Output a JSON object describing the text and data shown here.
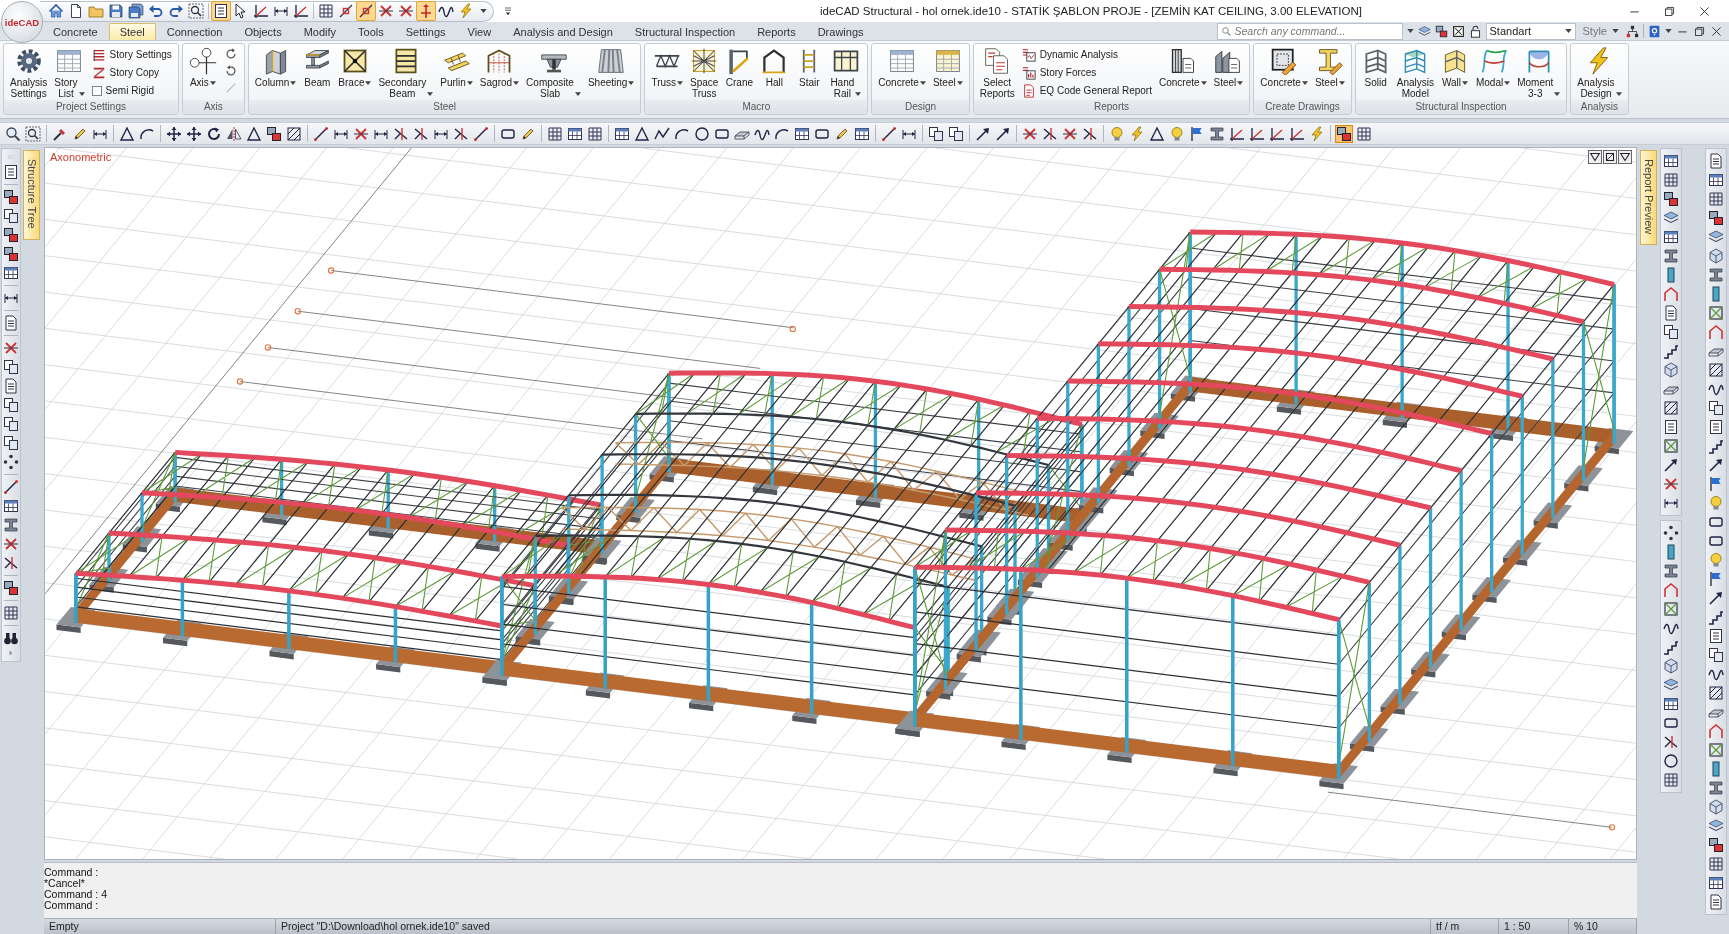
{
  "title_bar": {
    "logo": "ideCAD",
    "title": "ideCAD Structural - hol ornek.ide10 - STATİK ŞABLON PROJE - [ZEMİN KAT CEILING, 3.00 ELEVATION]"
  },
  "quick_access": [
    {
      "on": false
    },
    {
      "on": false
    },
    {
      "on": false
    },
    {
      "on": false
    },
    {
      "on": false
    },
    {
      "on": false
    },
    {
      "on": false
    },
    {
      "on": false
    },
    {
      "on": true
    },
    {
      "on": false
    },
    {
      "on": false
    },
    {
      "on": false
    },
    {
      "on": false
    },
    {
      "on": false
    },
    {
      "on": false
    },
    {
      "on": true
    },
    {
      "on": false
    },
    {
      "on": false
    },
    {
      "on": true
    },
    {
      "on": false
    },
    {
      "on": false
    }
  ],
  "tabs": [
    {
      "label": "Concrete",
      "selected": false
    },
    {
      "label": "Steel",
      "selected": true
    },
    {
      "label": "Connection",
      "selected": false
    },
    {
      "label": "Objects",
      "selected": false
    },
    {
      "label": "Modify",
      "selected": false
    },
    {
      "label": "Tools",
      "selected": false
    },
    {
      "label": "Settings",
      "selected": false
    },
    {
      "label": "View",
      "selected": false
    },
    {
      "label": "Analysis and Design",
      "selected": false
    },
    {
      "label": "Structural Inspection",
      "selected": false
    },
    {
      "label": "Reports",
      "selected": false
    },
    {
      "label": "Drawings",
      "selected": false
    }
  ],
  "search": {
    "placeholder": "Search any command..."
  },
  "style_dropdown": {
    "value": "Standart"
  },
  "style_menu": {
    "label": "Style"
  },
  "ribbon": [
    {
      "title": "Project Settings",
      "items": [
        {
          "kind": "large",
          "label": "Analysis Settings",
          "menu": false
        },
        {
          "kind": "large",
          "label": "Story List",
          "menu": true
        },
        {
          "kind": "small",
          "label": "Story Settings"
        },
        {
          "kind": "small",
          "label": "Story Copy"
        },
        {
          "kind": "check",
          "label": "Semi Rigid",
          "checked": false
        }
      ]
    },
    {
      "title": "Axis",
      "items": [
        {
          "kind": "large",
          "label": "Axis",
          "menu": true
        },
        {
          "kind": "icon"
        },
        {
          "kind": "icon"
        },
        {
          "kind": "icon"
        }
      ]
    },
    {
      "title": "Steel",
      "items": [
        {
          "kind": "large",
          "label": "Column",
          "menu": true
        },
        {
          "kind": "large",
          "label": "Beam",
          "menu": false
        },
        {
          "kind": "large",
          "label": "Brace",
          "menu": true
        },
        {
          "kind": "large",
          "label": "Secondary Beam",
          "menu": true
        },
        {
          "kind": "large",
          "label": "Purlin",
          "menu": true
        },
        {
          "kind": "large",
          "label": "Sagrod",
          "menu": true
        },
        {
          "kind": "large",
          "label": "Composite Slab",
          "menu": true
        },
        {
          "kind": "large",
          "label": "Sheeting",
          "menu": true
        }
      ]
    },
    {
      "title": "Macro",
      "items": [
        {
          "kind": "large",
          "label": "Truss",
          "menu": true
        },
        {
          "kind": "large",
          "label": "Space Truss",
          "menu": false
        },
        {
          "kind": "large",
          "label": "Crane",
          "menu": false
        },
        {
          "kind": "large",
          "label": "Hall",
          "menu": false
        },
        {
          "kind": "large",
          "label": "Stair",
          "menu": false
        },
        {
          "kind": "large",
          "label": "Hand Rail",
          "menu": true
        }
      ]
    },
    {
      "title": "Design",
      "items": [
        {
          "kind": "large",
          "label": "Concrete",
          "menu": true
        },
        {
          "kind": "large",
          "label": "Steel",
          "menu": true
        }
      ]
    },
    {
      "title": "Reports",
      "items": [
        {
          "kind": "large",
          "label": "Select Reports",
          "menu": false
        },
        {
          "kind": "small",
          "label": "Dynamic Analysis"
        },
        {
          "kind": "small",
          "label": "Story Forces"
        },
        {
          "kind": "small",
          "label": "EQ Code General Report"
        },
        {
          "kind": "large",
          "label": "Concrete",
          "menu": true
        },
        {
          "kind": "large",
          "label": "Steel",
          "menu": true
        }
      ]
    },
    {
      "title": "Create Drawings",
      "items": [
        {
          "kind": "large",
          "label": "Concrete",
          "menu": true
        },
        {
          "kind": "large",
          "label": "Steel",
          "menu": true
        }
      ]
    },
    {
      "title": "Structural Inspection",
      "items": [
        {
          "kind": "large",
          "label": "Solid",
          "menu": false
        },
        {
          "kind": "large",
          "label": "Analysis Model",
          "menu": false
        },
        {
          "kind": "large",
          "label": "Wall",
          "menu": true
        },
        {
          "kind": "large",
          "label": "Modal",
          "menu": true
        },
        {
          "kind": "large",
          "label": "Moment 3-3",
          "menu": true
        }
      ]
    },
    {
      "title": "Analysis",
      "items": [
        {
          "kind": "large",
          "label": "Analysis Design",
          "menu": true
        }
      ]
    }
  ],
  "toolbar": [
    {
      "on": false
    },
    {
      "on": false
    },
    {
      "on": false
    },
    {
      "on": false
    },
    {
      "on": false
    },
    {
      "on": false
    },
    {
      "on": false
    },
    {
      "on": false
    },
    {
      "on": false
    },
    {
      "on": false
    },
    {
      "on": false
    },
    {
      "on": false
    },
    {
      "on": false
    },
    {
      "on": false
    },
    {
      "on": false
    },
    {
      "on": false
    },
    {
      "on": false
    },
    {
      "on": false
    },
    {
      "on": false
    },
    {
      "on": false
    },
    {
      "on": false
    },
    {
      "on": false
    },
    {
      "on": false
    },
    {
      "on": false
    },
    {
      "on": false
    },
    {
      "on": false
    },
    {
      "on": false
    },
    {
      "on": false
    },
    {
      "on": false
    },
    {
      "on": false
    },
    {
      "on": false
    },
    {
      "on": false
    },
    {
      "on": false
    },
    {
      "on": false
    },
    {
      "on": false
    },
    {
      "on": false
    },
    {
      "on": false
    },
    {
      "on": false
    },
    {
      "on": false
    },
    {
      "on": false
    },
    {
      "on": false
    },
    {
      "on": false
    },
    {
      "on": false
    },
    {
      "on": false
    },
    {
      "on": false
    },
    {
      "on": false
    },
    {
      "on": false
    },
    {
      "on": false
    },
    {
      "on": false
    },
    {
      "on": false
    },
    {
      "on": false
    },
    {
      "on": false
    },
    {
      "on": false
    },
    {
      "on": false
    },
    {
      "on": false
    },
    {
      "on": false
    },
    {
      "on": false
    },
    {
      "on": false
    },
    {
      "on": false
    },
    {
      "on": false
    },
    {
      "on": false
    },
    {
      "on": false
    },
    {
      "on": true
    },
    {
      "on": false
    }
  ],
  "structure_tree_tab": {
    "label": "Structure Tree"
  },
  "viewport": {
    "view_label": "Axonometric"
  },
  "report_preview_tab": {
    "label": "Report Preview"
  },
  "command_log": [
    "Command :",
    "*Cancel*",
    "Command : 4",
    "Command :"
  ],
  "status_bar": [
    "Empty",
    "Project \"D:\\Download\\hol ornek.ide10\" saved",
    "tf / m",
    "1 : 50",
    "% 10"
  ]
}
